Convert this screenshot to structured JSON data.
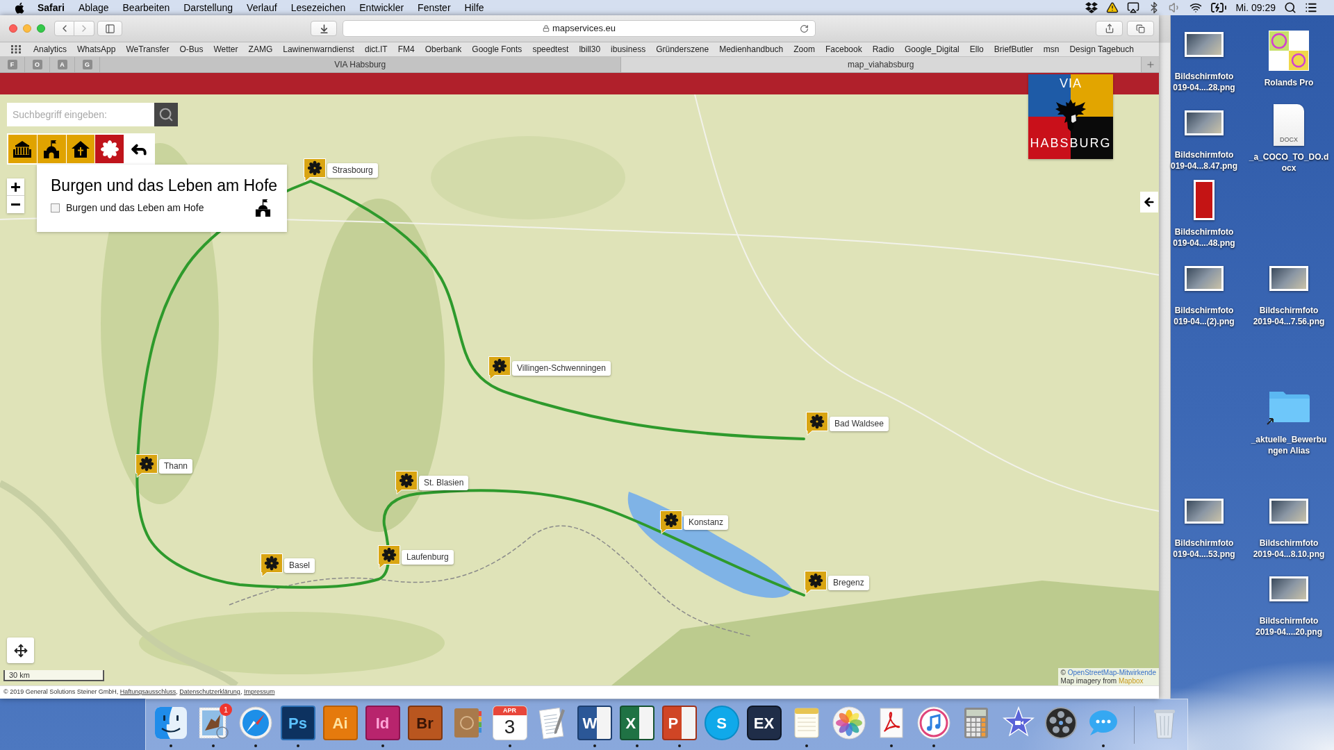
{
  "menu_bar": {
    "app_name": "Safari",
    "menus": [
      "Ablage",
      "Bearbeiten",
      "Darstellung",
      "Verlauf",
      "Lesezeichen",
      "Entwickler",
      "Fenster",
      "Hilfe"
    ],
    "clock": "Mi. 09:29"
  },
  "browser": {
    "address": "mapservices.eu",
    "bookmarks": [
      "Analytics",
      "WhatsApp",
      "WeTransfer",
      "O-Bus",
      "Wetter",
      "ZAMG",
      "Lawinenwarndienst",
      "dict.IT",
      "FM4",
      "Oberbank",
      "Google Fonts",
      "speedtest",
      "lbill30",
      "ibusiness",
      "Gründerszene",
      "Medienhandbuch",
      "Zoom",
      "Facebook",
      "Radio",
      "Google_Digital",
      "Ello",
      "BriefButler",
      "msn",
      "Design Tagebuch"
    ],
    "pinned_tabs": [
      "F",
      "O",
      "A",
      "G"
    ],
    "tabs": [
      {
        "label": "VIA Habsburg",
        "selected": false
      },
      {
        "label": "map_viahabsburg",
        "selected": true
      }
    ]
  },
  "map_page": {
    "logo": {
      "top": "VIA",
      "bottom": "HABSBURG"
    },
    "search": {
      "placeholder": "Suchbegriff eingeben:"
    },
    "categories": [
      {
        "kind": "building",
        "selected": false
      },
      {
        "kind": "castle",
        "selected": false
      },
      {
        "kind": "church",
        "selected": false
      },
      {
        "kind": "flower",
        "selected": true
      }
    ],
    "layer_panel": {
      "title": "Burgen und das Leben am Hofe",
      "layers": [
        {
          "label": "Burgen und das Leben am Hofe",
          "checked": false
        }
      ]
    },
    "markers": [
      {
        "label": "Strasbourg"
      },
      {
        "label": "Villingen-Schwenningen"
      },
      {
        "label": "Bad Waldsee"
      },
      {
        "label": "Thann"
      },
      {
        "label": "St. Blasien"
      },
      {
        "label": "Konstanz"
      },
      {
        "label": "Laufenburg"
      },
      {
        "label": "Basel"
      },
      {
        "label": "Bregenz"
      }
    ],
    "scale": "30 km",
    "attribution": {
      "osm_prefix": "©",
      "osm_link": "OpenStreetMap-Mitwirkende",
      "imagery_prefix": "Map imagery from",
      "imagery_link": "Mapbox"
    },
    "footer": {
      "copyright": "© 2019 General Solutions Steiner GmbH,",
      "links": [
        {
          "text": "Haftungsausschluss",
          "separator": ","
        },
        {
          "text": "Datenschutzerklärung",
          "separator": ","
        },
        {
          "text": "Impressum"
        }
      ]
    }
  },
  "desktop_icons": [
    {
      "kind": "screenshot",
      "lines": [
        "Bildschirmfoto",
        "019-04....28.png"
      ]
    },
    {
      "kind": "screenshot",
      "lines": [
        "Bildschirmfoto",
        "019-04...8.47.png"
      ]
    },
    {
      "kind": "portrait",
      "lines": [
        "Bildschirmfoto",
        "019-04....48.png"
      ]
    },
    {
      "kind": "screenshot",
      "lines": [
        "Bildschirmfoto",
        "019-04...(2).png"
      ]
    },
    {
      "kind": "screenshot",
      "lines": [
        "Bildschirmfoto",
        "019-04....53.png"
      ]
    },
    {
      "kind": "image",
      "lines": [
        "Rolands Pro"
      ]
    },
    {
      "kind": "document",
      "badge": "DOCX",
      "lines": [
        "_a_COCO_TO_DO.d",
        "ocx"
      ]
    },
    {
      "kind": "screenshot",
      "lines": [
        "Bildschirmfoto",
        "2019-04...7.56.png"
      ]
    },
    {
      "kind": "folder",
      "lines": [
        "_aktuelle_Bewerbu",
        "ngen Alias"
      ]
    },
    {
      "kind": "screenshot",
      "lines": [
        "Bildschirmfoto",
        "2019-04...8.10.png"
      ]
    },
    {
      "kind": "screenshot",
      "lines": [
        "Bildschirmfoto",
        "2019-04....20.png"
      ]
    }
  ],
  "dock": [
    {
      "kind": "finder",
      "running": true
    },
    {
      "kind": "mail",
      "running": true,
      "badge": "1"
    },
    {
      "kind": "safari",
      "running": true
    },
    {
      "kind": "photoshop",
      "label": "Ps",
      "running": true
    },
    {
      "kind": "illustrator",
      "label": "Ai",
      "running": false
    },
    {
      "kind": "indesign",
      "label": "Id",
      "running": true
    },
    {
      "kind": "bridge",
      "label": "Br",
      "running": false
    },
    {
      "kind": "contacts",
      "running": false
    },
    {
      "kind": "calendar",
      "month": "APR",
      "day": "3",
      "running": true
    },
    {
      "kind": "textedit",
      "running": false
    },
    {
      "kind": "word",
      "label": "W",
      "running": true
    },
    {
      "kind": "excel",
      "label": "X",
      "running": true
    },
    {
      "kind": "powerpoint",
      "label": "P",
      "running": true
    },
    {
      "kind": "skype",
      "label": "S",
      "running": false
    },
    {
      "kind": "exif",
      "label": "EX",
      "running": false
    },
    {
      "kind": "notes",
      "running": true
    },
    {
      "kind": "photos",
      "running": false
    },
    {
      "kind": "acrobat",
      "running": true
    },
    {
      "kind": "itunes",
      "running": true
    },
    {
      "kind": "calculator",
      "running": false
    },
    {
      "kind": "imovie",
      "running": false
    },
    {
      "kind": "dvd",
      "running": false
    },
    {
      "kind": "messages",
      "running": true
    }
  ]
}
